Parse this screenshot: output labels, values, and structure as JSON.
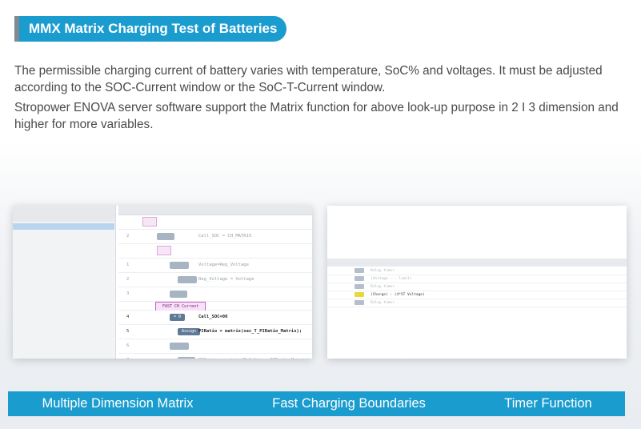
{
  "header": {
    "title": "MMX Matrix Charging Test of Batteries"
  },
  "body": {
    "paragraph1": "The permissible charging current of battery varies with temperature, SoC% and voltages. It must be adjusted according to the SOC-Current window or the SoC-T-Current window.",
    "paragraph2": "Stropower ENOVA server software support the Matrix function for above look-up purpose in 2 I 3 dimension and higher for more variables."
  },
  "left_screenshot": {
    "active_group": "FAST CH Current",
    "rows": [
      {
        "index": "4",
        "tag": "= 0",
        "code": "Call_SOC=00"
      },
      {
        "index": "5",
        "tag": "Assign",
        "code": "PIRatio = matrix(sec_T_PIRatio_Matrix);"
      }
    ]
  },
  "footer": {
    "items": [
      "Multiple Dimension Matrix",
      "Fast Charging Boundaries",
      "Timer Function"
    ]
  },
  "colors": {
    "accent": "#1a9ccf",
    "title_bar_marker": "#7f8a92",
    "body_text": "#4a4a4a"
  }
}
